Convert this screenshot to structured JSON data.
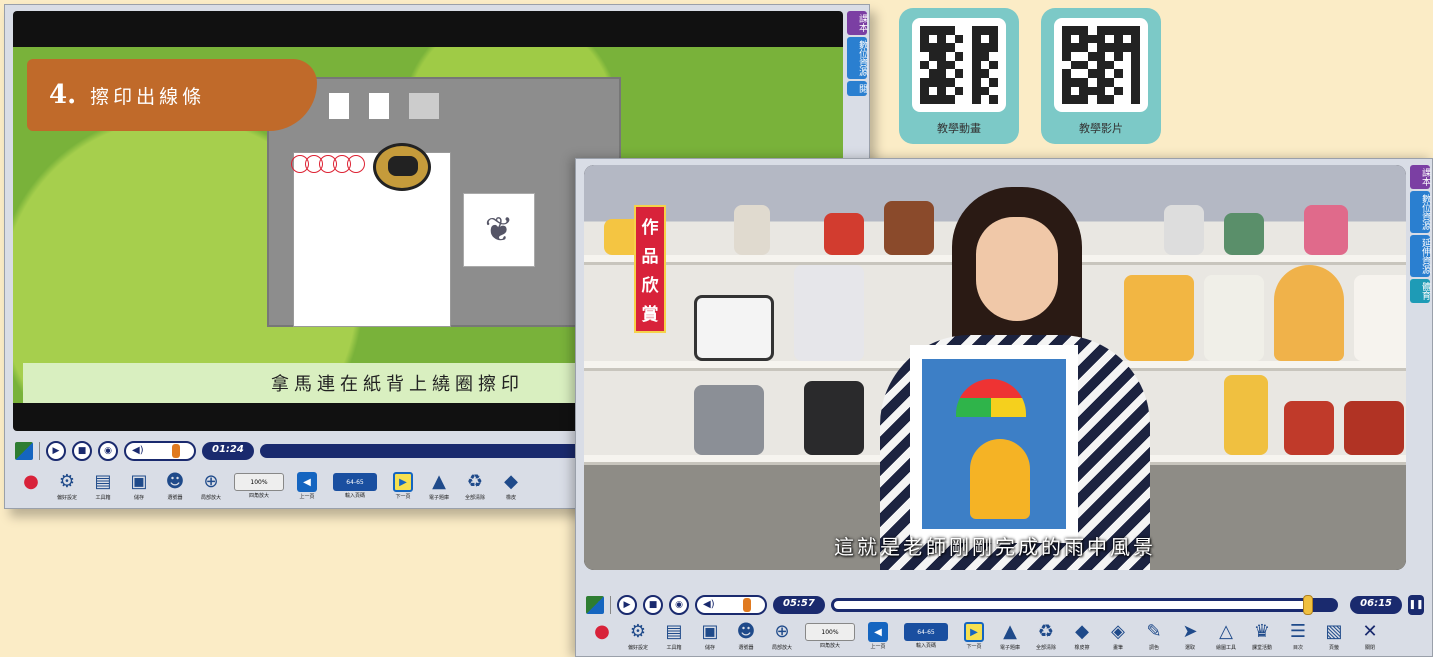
{
  "qr_codes": [
    {
      "label": "教學動畫"
    },
    {
      "label": "教學影片"
    }
  ],
  "back_player": {
    "title_number": "4.",
    "title_text": "擦印出線條",
    "subtitle": "拿馬連在紙背上繞圈擦印",
    "current_time": "01:24",
    "progress": 0.0,
    "side_tabs": [
      "課本",
      "數位資源",
      "閱"
    ]
  },
  "front_player": {
    "sign_text": [
      "作",
      "品",
      "欣",
      "賞"
    ],
    "subtitle": "這就是老師剛剛完成的雨中風景",
    "current_time": "05:57",
    "total_time": "06:15",
    "progress": 0.95,
    "side_tabs": [
      "課本",
      "數位資源",
      "延伸資源",
      "體育"
    ]
  },
  "toolbar_back": [
    {
      "icon": "apple-icon",
      "glyph": "●",
      "label": ""
    },
    {
      "icon": "gear-icon",
      "glyph": "⚙",
      "label": "偏好設定"
    },
    {
      "icon": "toolbox-icon",
      "glyph": "▤",
      "label": "工具箱"
    },
    {
      "icon": "save-icon",
      "glyph": "▣",
      "label": "儲存"
    },
    {
      "icon": "people-icon",
      "glyph": "☻",
      "label": "選號器"
    },
    {
      "icon": "zoom-icon",
      "glyph": "⊕",
      "label": "局部放大"
    },
    {
      "icon": "zoom-percent-icon",
      "glyph": "100%",
      "label": "四角放大"
    },
    {
      "icon": "prev-page-icon",
      "glyph": "◀",
      "label": "上一頁"
    },
    {
      "icon": "page-input-icon",
      "glyph": "64-65",
      "label": "輸入頁碼"
    },
    {
      "icon": "next-page-icon",
      "glyph": "▶",
      "label": "下一頁"
    },
    {
      "icon": "cap-icon",
      "glyph": "▲",
      "label": "電子題庫"
    },
    {
      "icon": "trash-icon",
      "glyph": "♻",
      "label": "全部清除"
    },
    {
      "icon": "eraser-icon",
      "glyph": "◆",
      "label": "橡皮"
    }
  ],
  "toolbar_front": [
    {
      "icon": "apple-icon",
      "glyph": "●",
      "label": ""
    },
    {
      "icon": "gear-icon",
      "glyph": "⚙",
      "label": "偏好設定"
    },
    {
      "icon": "toolbox-icon",
      "glyph": "▤",
      "label": "工具箱"
    },
    {
      "icon": "save-icon",
      "glyph": "▣",
      "label": "儲存"
    },
    {
      "icon": "people-icon",
      "glyph": "☻",
      "label": "選號器"
    },
    {
      "icon": "zoom-icon",
      "glyph": "⊕",
      "label": "局部放大"
    },
    {
      "icon": "zoom-percent-icon",
      "glyph": "100%",
      "label": "四角放大"
    },
    {
      "icon": "prev-page-icon",
      "glyph": "◀",
      "label": "上一頁"
    },
    {
      "icon": "page-input-icon",
      "glyph": "64-65",
      "label": "輸入頁碼"
    },
    {
      "icon": "next-page-icon",
      "glyph": "▶",
      "label": "下一頁"
    },
    {
      "icon": "cap-icon",
      "glyph": "▲",
      "label": "電子題庫"
    },
    {
      "icon": "trash-icon",
      "glyph": "♻",
      "label": "全部清除"
    },
    {
      "icon": "eraser-icon",
      "glyph": "◆",
      "label": "橡皮擦"
    },
    {
      "icon": "pen-icon",
      "glyph": "◈",
      "label": "畫筆"
    },
    {
      "icon": "palette-icon",
      "glyph": "✎",
      "label": "調色"
    },
    {
      "icon": "cursor-icon",
      "glyph": "➤",
      "label": "選取"
    },
    {
      "icon": "compass-icon",
      "glyph": "△",
      "label": "繪圖工具"
    },
    {
      "icon": "trophy-icon",
      "glyph": "♛",
      "label": "課堂活動"
    },
    {
      "icon": "menu-icon",
      "glyph": "☰",
      "label": "目次"
    },
    {
      "icon": "book-icon",
      "glyph": "▧",
      "label": "頁籤"
    },
    {
      "icon": "close-icon",
      "glyph": "✕",
      "label": "關閉"
    }
  ],
  "colors": {
    "page_bg": "#fbecc6",
    "qr_card": "#7cc9c7",
    "accent_navy": "#1a2a6e",
    "title_banner": "#c06a2a",
    "sign_red": "#d8223a"
  }
}
